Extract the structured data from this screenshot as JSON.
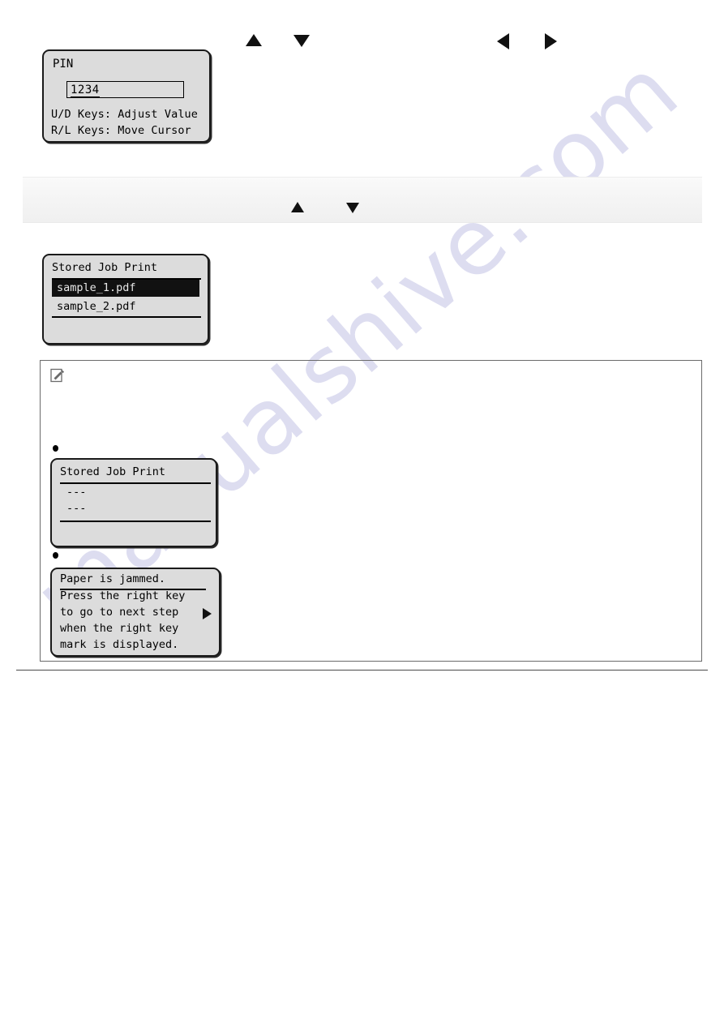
{
  "watermark": {
    "text": "manualshive.com",
    "color": "#c9c9e8"
  },
  "key_arrows_top": {
    "up": {
      "icon": "triangle-up-icon",
      "label": "Up key"
    },
    "down": {
      "icon": "triangle-down-icon",
      "label": "Down key"
    },
    "left": {
      "icon": "triangle-left-icon",
      "label": "Left key"
    },
    "right": {
      "icon": "triangle-right-icon",
      "label": "Right key"
    }
  },
  "pin_screen": {
    "title": "PIN",
    "value": "1234",
    "value_head": "123",
    "value_cursor": "4",
    "hint_up_down": "U/D Keys: Adjust Value",
    "hint_right_left": "R/L Keys: Move Cursor"
  },
  "band": {
    "arrow_up": "triangle-up-icon",
    "arrow_down": "triangle-down-icon"
  },
  "stored_job_print": {
    "title": "Stored Job Print",
    "items": [
      {
        "label": "sample_1.pdf",
        "selected": true
      },
      {
        "label": "sample_2.pdf",
        "selected": false
      }
    ]
  },
  "note_box": {
    "icon": "note-pencil-icon",
    "bullets": [
      {
        "marker": "●"
      },
      {
        "marker": "●"
      }
    ]
  },
  "stored_job_print_dashes": {
    "title": "Stored Job Print",
    "items": [
      {
        "label": "---"
      },
      {
        "label": "---"
      }
    ]
  },
  "paper_jam_screen": {
    "title": "Paper is jammed.",
    "lines": [
      "Press the right key",
      "to go to next step",
      "when the right key",
      "mark is displayed."
    ],
    "right_key_marker": "triangle-right-icon"
  }
}
